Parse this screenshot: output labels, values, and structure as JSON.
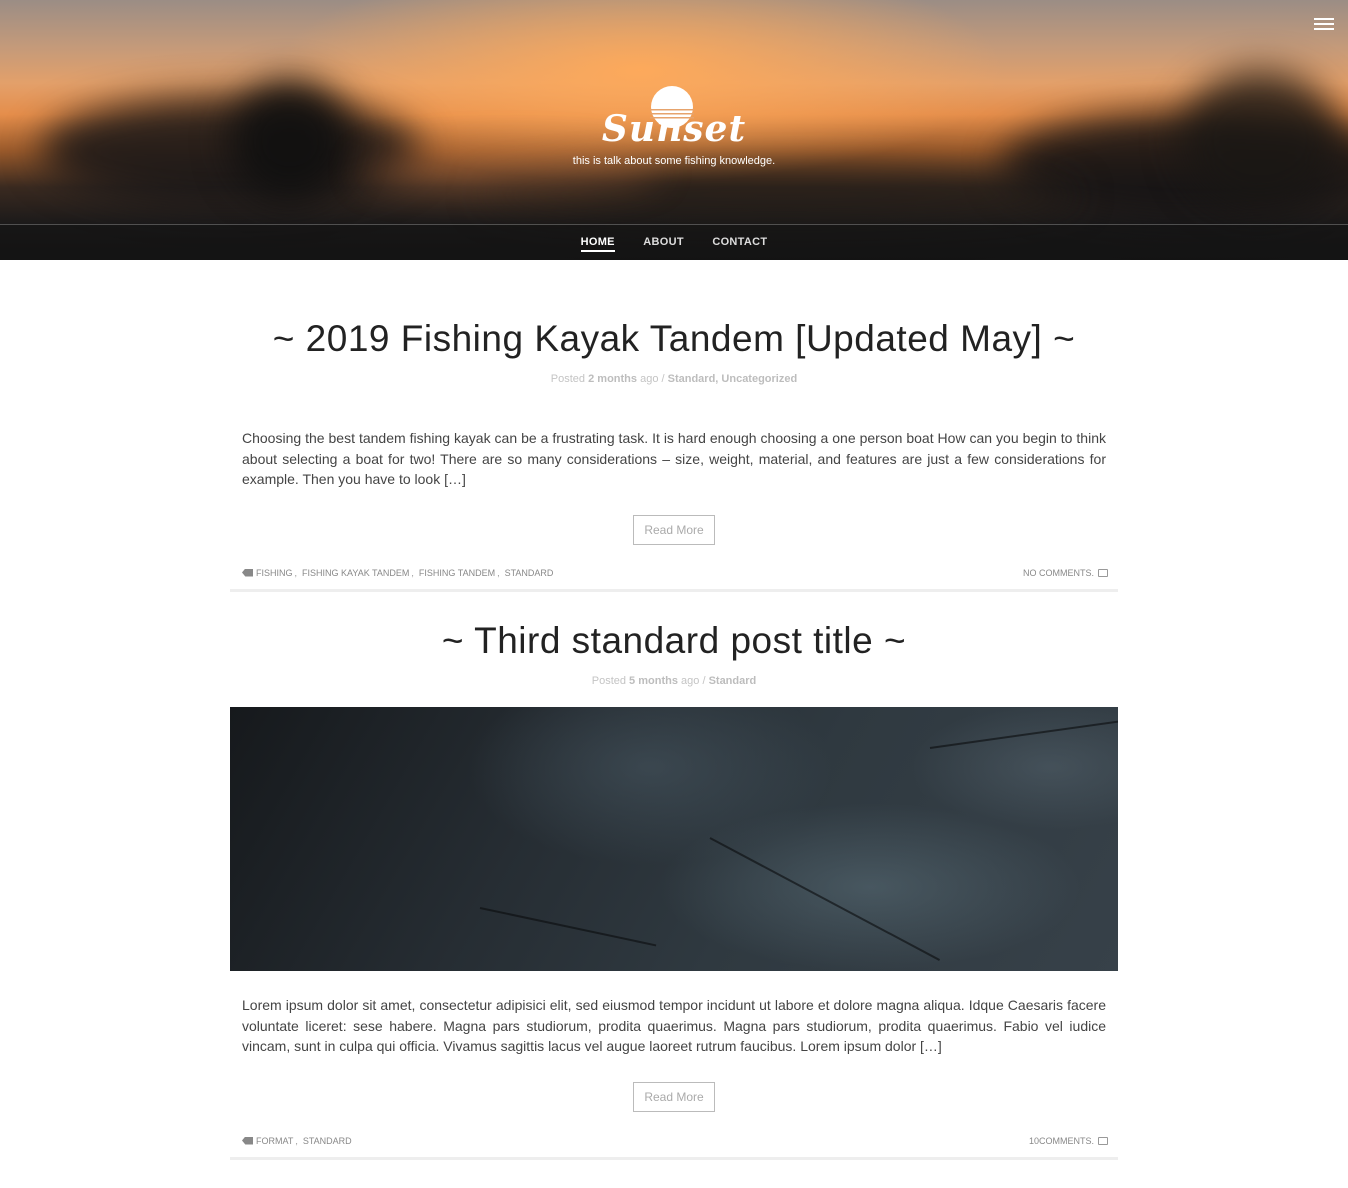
{
  "site": {
    "logo_text": "Sunset",
    "tagline": "this is talk about some fishing knowledge.",
    "menu_icon": "hamburger-icon"
  },
  "nav": {
    "items": [
      {
        "label": "HOME",
        "active": true
      },
      {
        "label": "ABOUT",
        "active": false
      },
      {
        "label": "CONTACT",
        "active": false
      }
    ]
  },
  "posts": [
    {
      "title": "~ 2019 Fishing Kayak Tandem [Updated May] ~",
      "meta_posted": "Posted",
      "meta_time": "2 months",
      "meta_ago": "ago",
      "meta_sep": "/",
      "meta_categories": "Standard, Uncategorized",
      "excerpt": "Choosing the best tandem fishing kayak can be a frustrating task. It is hard enough choosing a one person boat How can you begin to think about selecting a boat for two! There are so many considerations – size, weight, material, and features are just a few considerations for example. Then you have to look […]",
      "read_more": "Read More",
      "tags": [
        "FISHING",
        "FISHING KAYAK TANDEM",
        "FISHING TANDEM",
        "STANDARD"
      ],
      "comments": "NO COMMENTS."
    },
    {
      "title": "~ Third standard post title ~",
      "meta_posted": "Posted",
      "meta_time": "5 months",
      "meta_ago": "ago",
      "meta_sep": "/",
      "meta_categories": "Standard",
      "excerpt": "Lorem ipsum dolor sit amet, consectetur adipisici elit, sed eiusmod tempor incidunt ut labore et dolore magna aliqua. Idque Caesaris facere voluntate liceret: sese habere. Magna pars studiorum, prodita quaerimus. Magna pars studiorum, prodita quaerimus. Fabio vel iudice vincam, sunt in culpa qui officia. Vivamus sagittis lacus vel augue laoreet rutrum faucibus. Lorem ipsum dolor […]",
      "read_more": "Read More",
      "tags": [
        "FORMAT",
        "STANDARD"
      ],
      "comments": "10COMMENTS."
    }
  ]
}
